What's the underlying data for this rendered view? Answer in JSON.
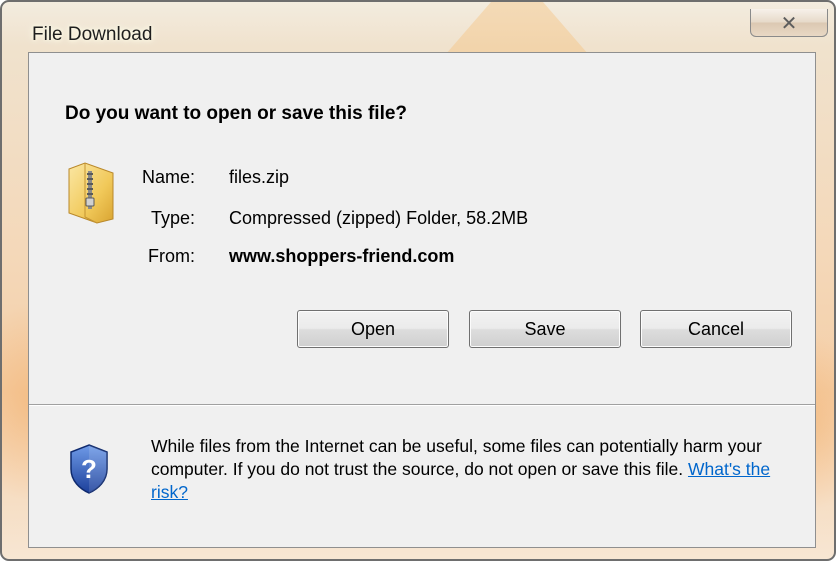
{
  "window": {
    "title": "File Download",
    "close_glyph": "✕"
  },
  "dialog": {
    "question": "Do you want to open or save this file?",
    "file_icon": "zip-folder-icon",
    "name_label": "Name:",
    "name_value": "files.zip",
    "type_label": "Type:",
    "type_value": "Compressed (zipped) Folder, 58.2MB",
    "from_label": "From:",
    "from_value": "www.shoppers-friend.com"
  },
  "buttons": {
    "open": "Open",
    "save": "Save",
    "cancel": "Cancel"
  },
  "warning": {
    "icon": "security-shield-question-icon",
    "text": "While files from the Internet can be useful, some files can potentially harm your computer. If you do not trust the source, do not open or save this file.",
    "link_text": "What's the risk?"
  },
  "colors": {
    "link": "#0066cc",
    "frame_tint": "#f5cfa8"
  }
}
